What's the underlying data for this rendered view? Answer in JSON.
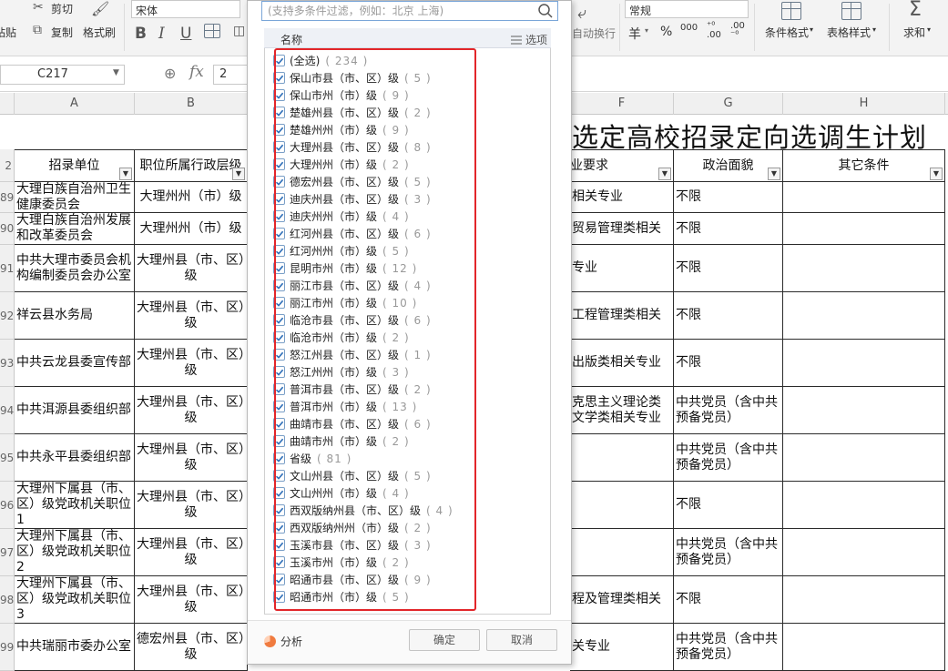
{
  "ribbon": {
    "paste_label": "粘贴",
    "cut_label": "剪切",
    "copy_label": "复制",
    "format_painter_label": "格式刷",
    "font_name": "宋体",
    "bold": "B",
    "italic": "I",
    "underline": "U",
    "auto_wrap_label": "自动换行",
    "number_format": "常规",
    "currency_symbol": "羊",
    "percent_symbol": "%",
    "thousands_symbol": "000",
    "conditional_format_label": "条件格式",
    "table_style_label": "表格样式",
    "sum_label": "求和",
    "sigma": "Σ"
  },
  "formula_bar": {
    "cell_ref": "C217",
    "fx": "fx",
    "value": "2"
  },
  "sheet": {
    "columns": [
      "A",
      "B",
      "F",
      "G",
      "H"
    ],
    "title": "选定高校招录定向选调生计划",
    "headers": {
      "a": "招录单位",
      "b": "职位所属行政层级",
      "f": "业要求",
      "g": "政治面貌",
      "h": "其它条件"
    },
    "header_row_label": "2",
    "rows": [
      {
        "num": "89",
        "a": "大理白族自治州卫生健康委员会",
        "b": "大理州州（市）级",
        "f": "相关专业",
        "g": "不限"
      },
      {
        "num": "90",
        "a": "大理白族自治州发展和改革委员会",
        "b": "大理州州（市）级",
        "f": "贸易管理类相关",
        "g": "不限"
      },
      {
        "num": "91",
        "a": "中共大理市委员会机构编制委员会办公室",
        "b": "大理州县（市、区）级",
        "f": "专业",
        "g": "不限"
      },
      {
        "num": "92",
        "a": "祥云县水务局",
        "b": "大理州县（市、区）级",
        "f": "工程管理类相关",
        "g": "不限"
      },
      {
        "num": "93",
        "a": "中共云龙县委宣传部",
        "b": "大理州县（市、区）级",
        "f": "出版类相关专业",
        "g": "不限"
      },
      {
        "num": "94",
        "a": "中共洱源县委组织部",
        "b": "大理州县（市、区）级",
        "f": "克思主义理论类文学类相关专业",
        "g": "中共党员（含中共预备党员）"
      },
      {
        "num": "95",
        "a": "中共永平县委组织部",
        "b": "大理州县（市、区）级",
        "f": "",
        "g": "中共党员（含中共预备党员）"
      },
      {
        "num": "96",
        "a": "大理州下属县（市、区）级党政机关职位1",
        "b": "大理州县（市、区）级",
        "f": "",
        "g": "不限"
      },
      {
        "num": "97",
        "a": "大理州下属县（市、区）级党政机关职位2",
        "b": "大理州县（市、区）级",
        "f": "",
        "g": "中共党员（含中共预备党员）"
      },
      {
        "num": "98",
        "a": "大理州下属县（市、区）级党政机关职位3",
        "b": "大理州县（市、区）级",
        "f": "程及管理类相关",
        "g": "不限"
      },
      {
        "num": "99",
        "a": "中共瑞丽市委办公室",
        "b": "德宏州县（市、区）级",
        "f": "关专业",
        "g": "中共党员（含中共预备党员）"
      }
    ]
  },
  "filter_panel": {
    "search_placeholder": "(支持多条件过滤，例如：北京 上海)",
    "header_name": "名称",
    "header_options": "选项",
    "items": [
      {
        "label": "(全选)",
        "count": "( 234 )"
      },
      {
        "label": "保山市县（市、区）级",
        "count": "( 5 )"
      },
      {
        "label": "保山市州（市）级",
        "count": "( 9 )"
      },
      {
        "label": "楚雄州县（市、区）级",
        "count": "( 2 )"
      },
      {
        "label": "楚雄州州（市）级",
        "count": "( 9 )"
      },
      {
        "label": "大理州县（市、区）级",
        "count": "( 8 )"
      },
      {
        "label": "大理州州（市）级",
        "count": "( 2 )"
      },
      {
        "label": "德宏州县（市、区）级",
        "count": "( 5 )"
      },
      {
        "label": "迪庆州县（市、区）级",
        "count": "( 3 )"
      },
      {
        "label": "迪庆州州（市）级",
        "count": "( 4 )"
      },
      {
        "label": "红河州县（市、区）级",
        "count": "( 6 )"
      },
      {
        "label": "红河州州（市）级",
        "count": "( 5 )"
      },
      {
        "label": "昆明市州（市）级",
        "count": "( 12 )"
      },
      {
        "label": "丽江市县（市、区）级",
        "count": "( 4 )"
      },
      {
        "label": "丽江市州（市）级",
        "count": "( 10 )"
      },
      {
        "label": "临沧市县（市、区）级",
        "count": "( 6 )"
      },
      {
        "label": "临沧市州（市）级",
        "count": "( 2 )"
      },
      {
        "label": "怒江州县（市、区）级",
        "count": "( 1 )"
      },
      {
        "label": "怒江州州（市）级",
        "count": "( 3 )"
      },
      {
        "label": "普洱市县（市、区）级",
        "count": "( 2 )"
      },
      {
        "label": "普洱市州（市）级",
        "count": "( 13 )"
      },
      {
        "label": "曲靖市县（市、区）级",
        "count": "( 6 )"
      },
      {
        "label": "曲靖市州（市）级",
        "count": "( 2 )"
      },
      {
        "label": "省级",
        "count": "( 81 )"
      },
      {
        "label": "文山州县（市、区）级",
        "count": "( 5 )"
      },
      {
        "label": "文山州州（市）级",
        "count": "( 4 )"
      },
      {
        "label": "西双版纳州县（市、区）级",
        "count": "( 4 )"
      },
      {
        "label": "西双版纳州州（市）级",
        "count": "( 2 )"
      },
      {
        "label": "玉溪市县（市、区）级",
        "count": "( 3 )"
      },
      {
        "label": "玉溪市州（市）级",
        "count": "( 2 )"
      },
      {
        "label": "昭通市县（市、区）级",
        "count": "( 9 )"
      },
      {
        "label": "昭通市州（市）级",
        "count": "( 5 )"
      }
    ],
    "analysis_label": "分析",
    "ok_label": "确定",
    "cancel_label": "取消"
  },
  "colors": {
    "highlight_border": "#e2262a",
    "checkbox_check": "#2f6fb8",
    "search_border": "#7aa6d8"
  }
}
